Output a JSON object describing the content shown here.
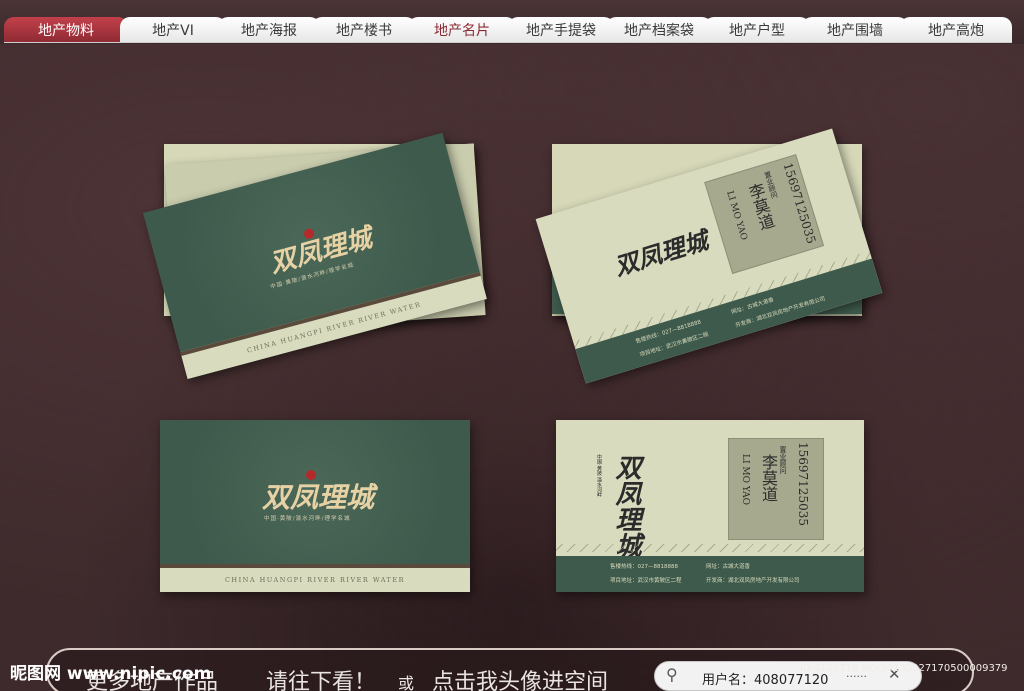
{
  "tabs": [
    {
      "label": "地产物料",
      "active": true
    },
    {
      "label": "地产VI",
      "active": false
    },
    {
      "label": "地产海报",
      "active": false
    },
    {
      "label": "地产楼书",
      "active": false
    },
    {
      "label": "地产名片",
      "active": false,
      "highlight": true
    },
    {
      "label": "地产手提袋",
      "active": false
    },
    {
      "label": "地产档案袋",
      "active": false
    },
    {
      "label": "地产户型",
      "active": false
    },
    {
      "label": "地产围墙",
      "active": false
    },
    {
      "label": "地产高炮",
      "active": false
    }
  ],
  "card_front": {
    "logo": "双凤理城",
    "slogan": "中国·黄陂/滠水河畔/理学名城",
    "footer": "CHINA HUANGPI    RIVER RIVER WATER"
  },
  "card_back": {
    "logo": "双凤理城",
    "side_text": "中国·黄陂 滠水河畔",
    "phone": "15697125035",
    "title": "置业顾问",
    "name": "李莫道",
    "name_en": "LI MO YAO",
    "hotline": "售楼热线：027—8818888",
    "website": "网站：www.sflc.com",
    "project_addr": "项目地址：武汉市黄陂区二程",
    "website_right": "网址：古城大道香",
    "developer": "开发商：湖北双凤房地产开发有限公司"
  },
  "bottom": {
    "text_more": "更多地产作品",
    "text_go": "请往下看！",
    "text_or": "或",
    "text_click": "点击我头像进空间",
    "user_label": "用户名：408077120",
    "user_dots": "......",
    "site_logo": "昵图网 www.nipic.com",
    "image_id": "ID:4121716 NO:20130927170500009379"
  }
}
